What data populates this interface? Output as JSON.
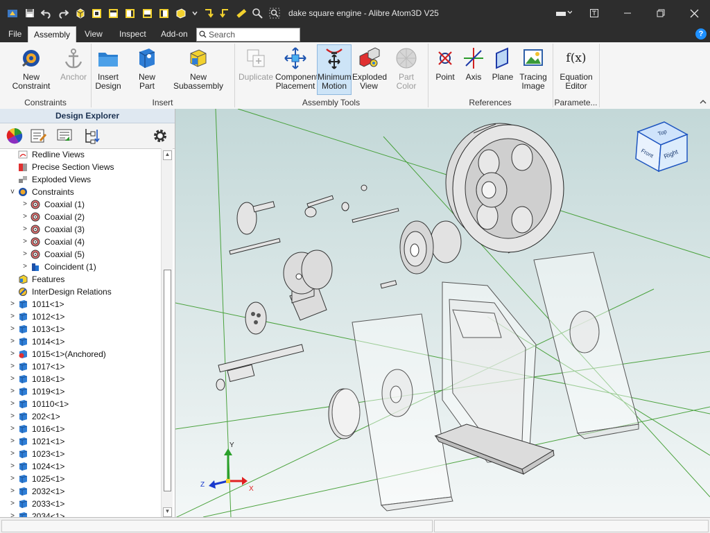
{
  "titlebar": {
    "title": "dake square engine - Alibre Atom3D V25"
  },
  "menu": {
    "file": "File",
    "assembly": "Assembly",
    "view": "View",
    "inspect": "Inspect",
    "addon": "Add-on",
    "search_placeholder": "Search"
  },
  "ribbon": {
    "new_constraint": "New Constraint",
    "anchor": "Anchor",
    "insert_design_1": "Insert",
    "insert_design_2": "Design",
    "new_part": "New Part",
    "new_subassembly": "New Subassembly",
    "duplicate": "Duplicate",
    "component_placement_1": "Component",
    "component_placement_2": "Placement",
    "minimum_motion_1": "Minimum",
    "minimum_motion_2": "Motion",
    "exploded_view_1": "Exploded",
    "exploded_view_2": "View",
    "part_color": "Part Color",
    "point": "Point",
    "axis": "Axis",
    "plane": "Plane",
    "tracing_image_1": "Tracing",
    "tracing_image_2": "Image",
    "equation_editor_1": "Equation",
    "equation_editor_2": "Editor",
    "fx": "f(x)",
    "groups": {
      "constraints": "Constraints",
      "insert": "Insert",
      "assembly_tools": "Assembly Tools",
      "references": "References",
      "parameters": "Paramete..."
    }
  },
  "explorer": {
    "title": "Design Explorer",
    "tree": [
      {
        "label": "Redline Views",
        "icon": "redline-icon",
        "expander": ""
      },
      {
        "label": "Precise Section Views",
        "icon": "section-icon",
        "expander": ""
      },
      {
        "label": "Exploded Views",
        "icon": "exploded-icon",
        "expander": ""
      },
      {
        "label": "Constraints",
        "icon": "constraints-icon",
        "expander": "v"
      },
      {
        "label": "Coaxial (1)",
        "icon": "coaxial-icon",
        "expander": ">"
      },
      {
        "label": "Coaxial (2)",
        "icon": "coaxial-icon",
        "expander": ">"
      },
      {
        "label": "Coaxial (3)",
        "icon": "coaxial-icon",
        "expander": ">"
      },
      {
        "label": "Coaxial (4)",
        "icon": "coaxial-icon",
        "expander": ">"
      },
      {
        "label": "Coaxial (5)",
        "icon": "coaxial-icon",
        "expander": ">"
      },
      {
        "label": "Coincident (1)",
        "icon": "coincident-icon",
        "expander": ">"
      },
      {
        "label": "Features",
        "icon": "features-icon",
        "expander": ""
      },
      {
        "label": "InterDesign Relations",
        "icon": "relations-icon",
        "expander": ""
      },
      {
        "label": "1011<1>",
        "icon": "part-icon",
        "expander": ">"
      },
      {
        "label": "1012<1>",
        "icon": "part-icon",
        "expander": ">"
      },
      {
        "label": "1013<1>",
        "icon": "part-icon",
        "expander": ">"
      },
      {
        "label": "1014<1>",
        "icon": "part-icon",
        "expander": ">"
      },
      {
        "label": "1015<1>(Anchored)",
        "icon": "anchored-part-icon",
        "expander": ">"
      },
      {
        "label": "1017<1>",
        "icon": "part-icon",
        "expander": ">"
      },
      {
        "label": "1018<1>",
        "icon": "part-icon",
        "expander": ">"
      },
      {
        "label": "1019<1>",
        "icon": "part-icon",
        "expander": ">"
      },
      {
        "label": "10110<1>",
        "icon": "part-icon",
        "expander": ">"
      },
      {
        "label": "202<1>",
        "icon": "part-icon",
        "expander": ">"
      },
      {
        "label": "1016<1>",
        "icon": "part-icon",
        "expander": ">"
      },
      {
        "label": "1021<1>",
        "icon": "part-icon",
        "expander": ">"
      },
      {
        "label": "1023<1>",
        "icon": "part-icon",
        "expander": ">"
      },
      {
        "label": "1024<1>",
        "icon": "part-icon",
        "expander": ">"
      },
      {
        "label": "1025<1>",
        "icon": "part-icon",
        "expander": ">"
      },
      {
        "label": "2032<1>",
        "icon": "part-icon",
        "expander": ">"
      },
      {
        "label": "2033<1>",
        "icon": "part-icon",
        "expander": ">"
      },
      {
        "label": "2034<1>",
        "icon": "part-icon",
        "expander": ">"
      }
    ]
  },
  "viewcube": {
    "top": "Top",
    "front": "Front",
    "right": "Right"
  },
  "triad": {
    "x": "X",
    "y": "Y",
    "z": "Z"
  },
  "colors": {
    "accent": "#1e6fd0",
    "titlebar": "#2d2d2d",
    "grid": "#3a9a2a",
    "axis_x": "#e02020",
    "axis_y": "#2aa02a",
    "axis_z": "#1a3acd"
  }
}
